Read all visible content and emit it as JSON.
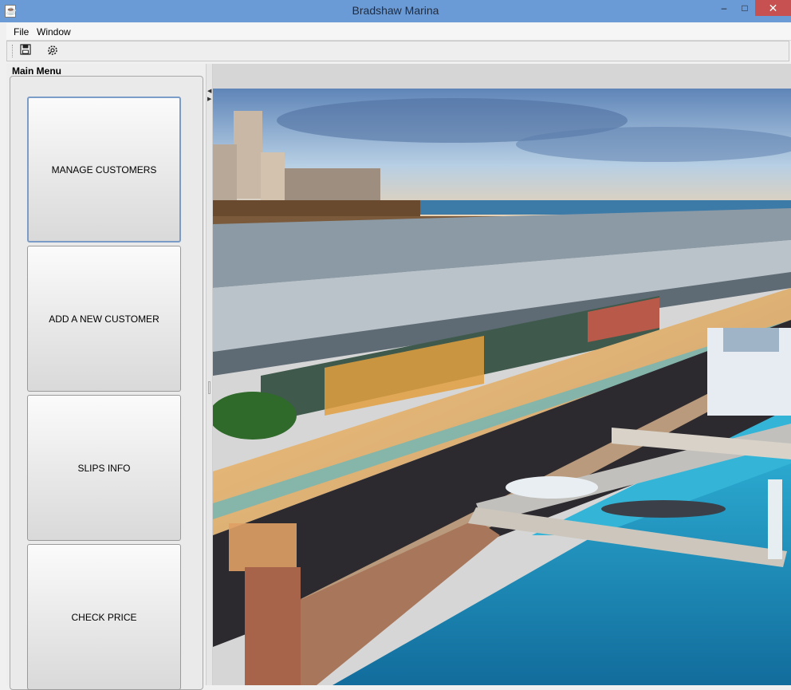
{
  "window": {
    "title": "Bradshaw Marina",
    "minimize": "–",
    "maximize": "□",
    "close": "✕"
  },
  "menubar": {
    "file": "File",
    "window": "Window"
  },
  "toolbar": {
    "save_icon": "save-icon",
    "settings_icon": "settings-icon"
  },
  "sidebar": {
    "title": "Main Menu",
    "buttons": [
      {
        "label": "MANAGE CUSTOMERS"
      },
      {
        "label": "ADD A NEW CUSTOMER"
      },
      {
        "label": "SLIPS INFO"
      },
      {
        "label": "CHECK PRICE"
      }
    ]
  },
  "colors": {
    "titlebar": "#6b9bd6",
    "close_button": "#c75050",
    "water": "#1e9fc8",
    "sky": "#8ab3d6"
  }
}
